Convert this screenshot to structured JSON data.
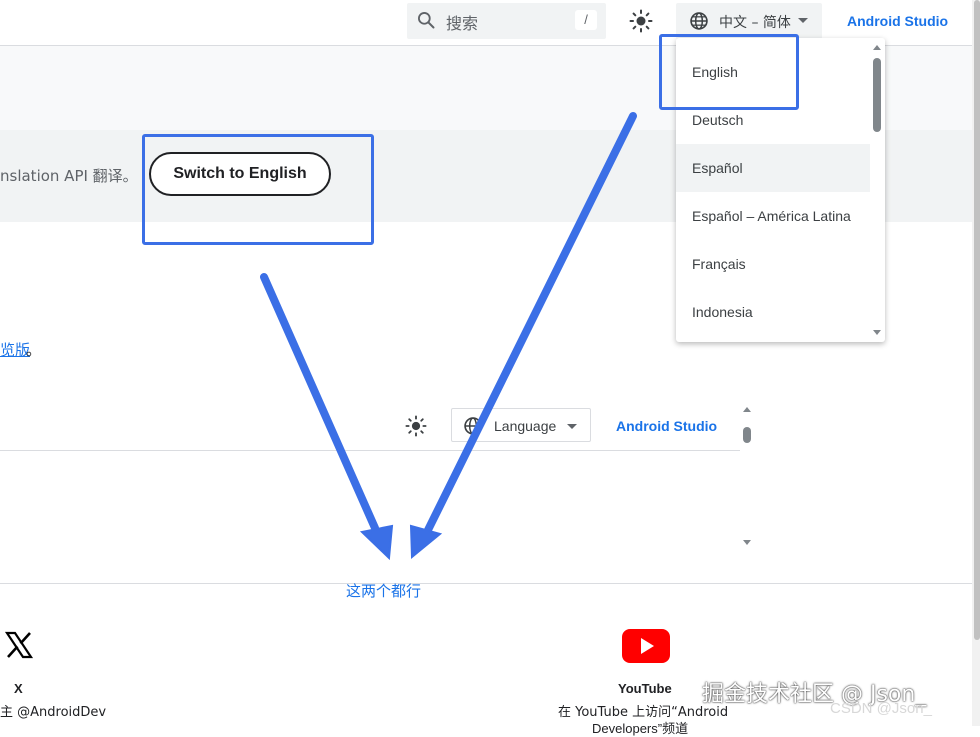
{
  "header": {
    "search_placeholder": "搜索",
    "search_shortcut": "/",
    "language_selected": "中文 – 简体",
    "studio_link": "Android Studio"
  },
  "language_menu": {
    "items": [
      "English",
      "Deutsch",
      "Español",
      "Español – América Latina",
      "Français",
      "Indonesia"
    ],
    "hovered_item": "Español"
  },
  "banner": {
    "text": "nslation API 翻译。",
    "switch_button": "Switch to English"
  },
  "body": {
    "preview_link": "览版",
    "preview_punct": "。"
  },
  "inner_header": {
    "language_button": "Language",
    "studio_link": "Android Studio"
  },
  "annotation": {
    "caption": "这两个都行",
    "color": "#3b6fe6"
  },
  "footer": {
    "x": {
      "title": "X",
      "desc": "主 @AndroidDev"
    },
    "youtube": {
      "title": "YouTube",
      "desc": "在 YouTube 上访问“Android",
      "desc2": "Developers”频道"
    }
  },
  "watermark": {
    "main": "掘金技术社区 @ Json_",
    "sub": "CSDN @Json_"
  }
}
